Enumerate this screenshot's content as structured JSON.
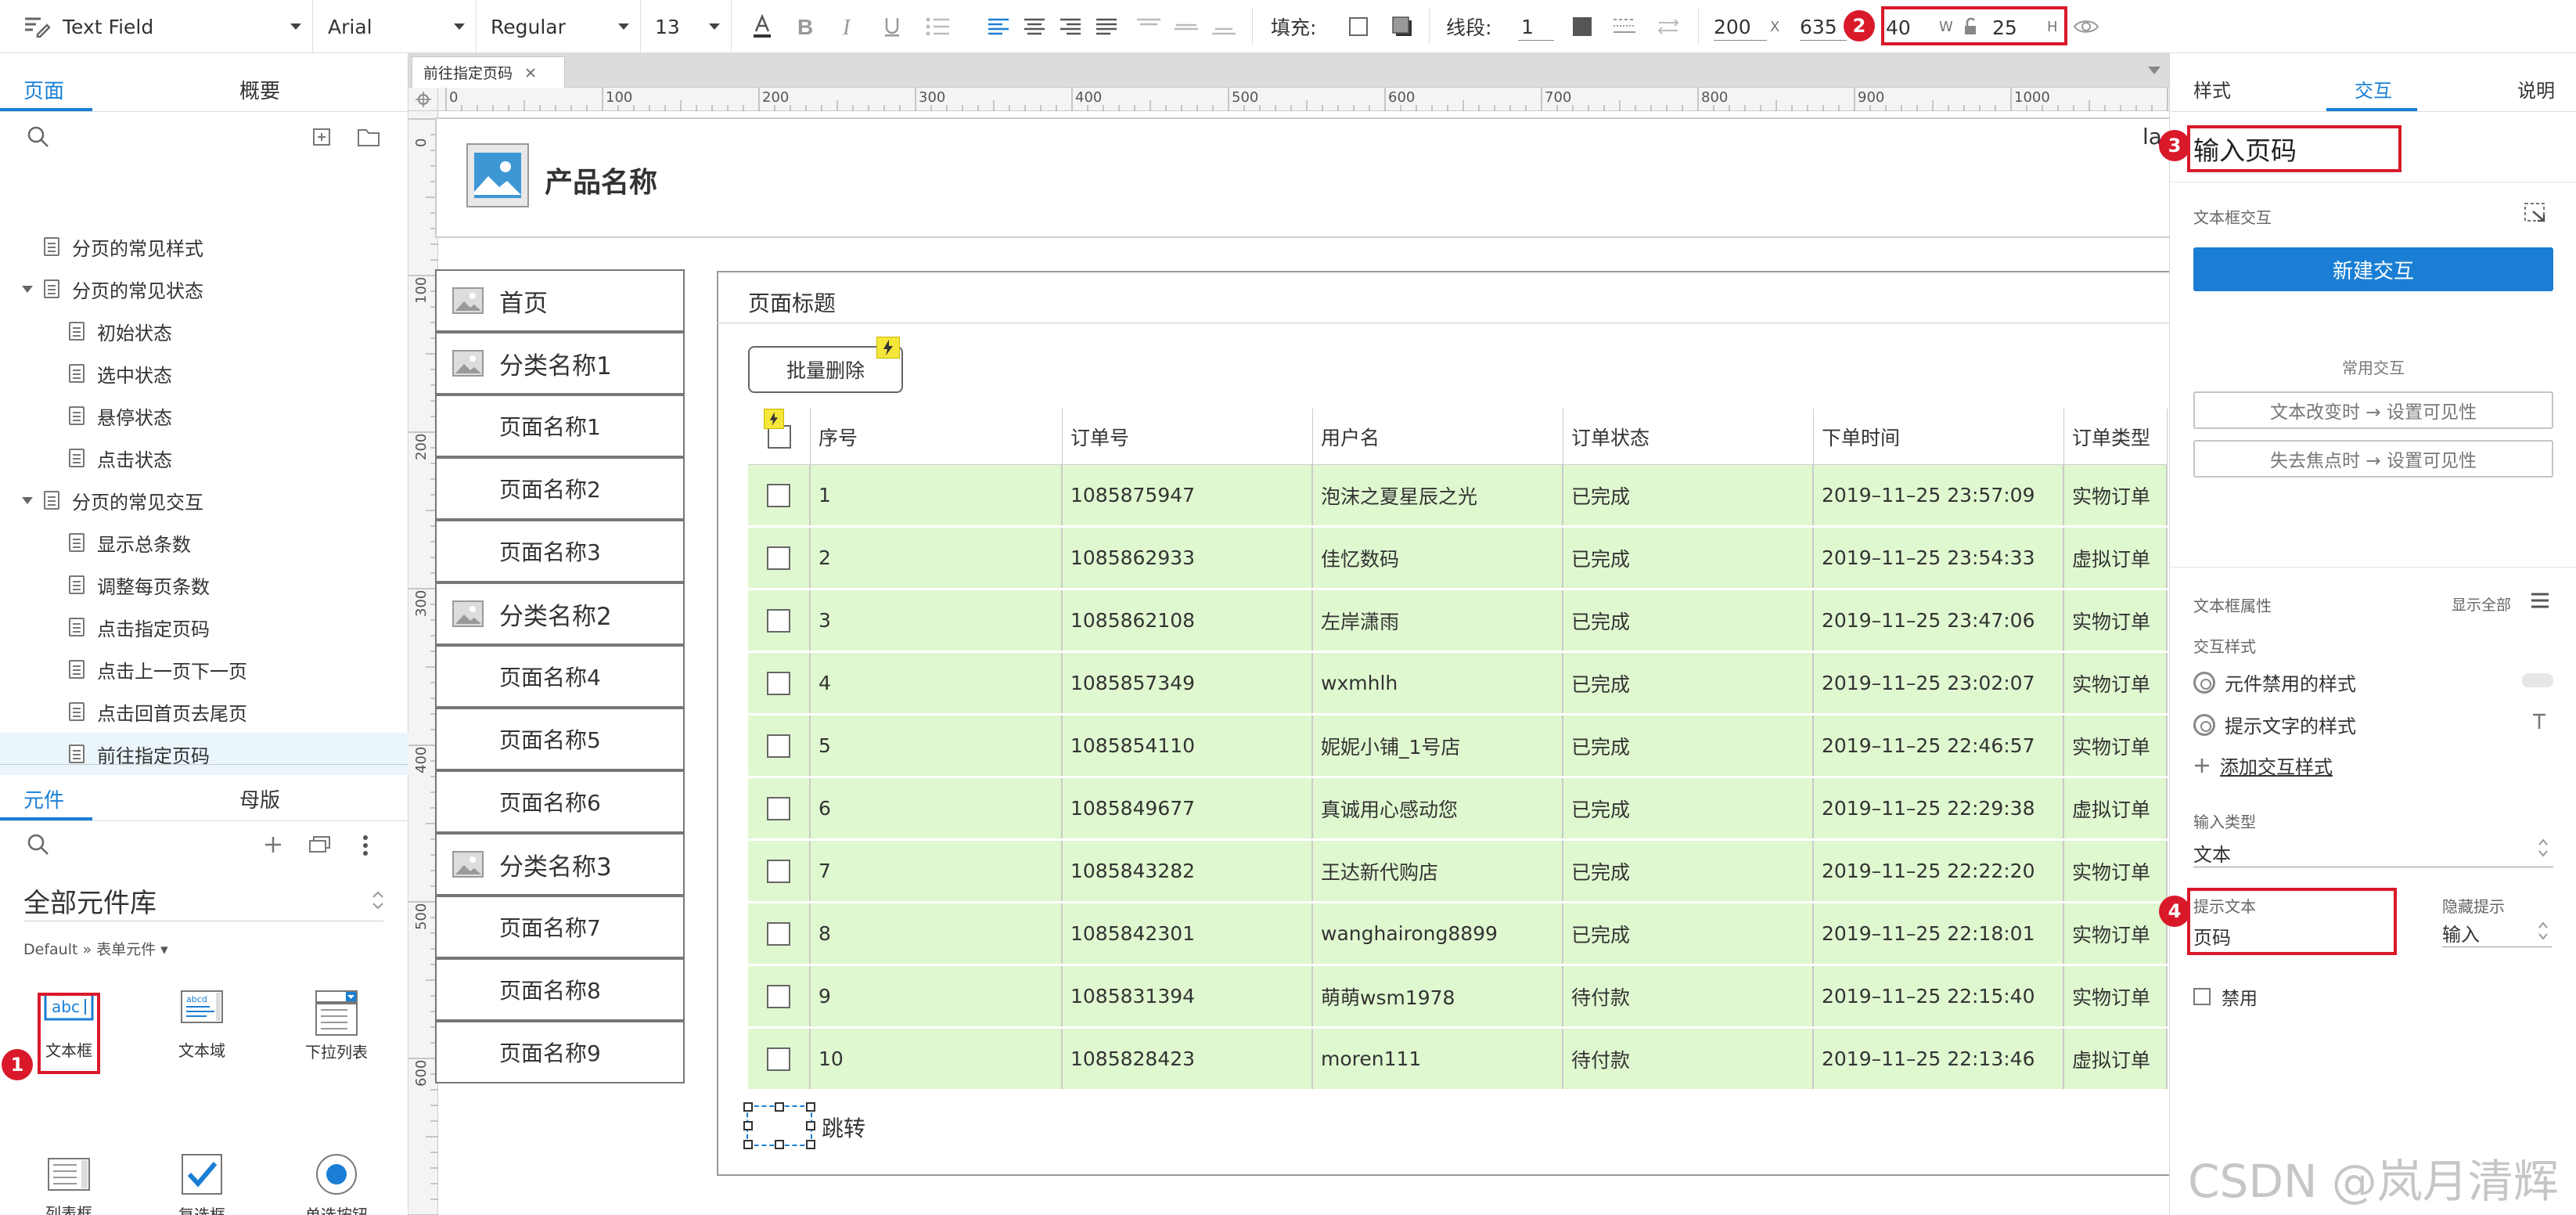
{
  "toolbar": {
    "widget_type": "Text Field",
    "font_family": "Arial",
    "font_style": "Regular",
    "font_size": "13",
    "fill_label": "填充:",
    "stroke_label": "线段:",
    "stroke_width": "1",
    "x": "200",
    "x_sep": "X",
    "y": "635",
    "w": "40",
    "w_label": "W",
    "h": "25",
    "h_label": "H"
  },
  "left_panel": {
    "tabs": [
      "页面",
      "概要"
    ],
    "active_tab": "页面",
    "tree": [
      {
        "label": "分页的常见样式",
        "level": 0,
        "expandable": false,
        "selected": false
      },
      {
        "label": "分页的常见状态",
        "level": 0,
        "expandable": true,
        "selected": false
      },
      {
        "label": "初始状态",
        "level": 1,
        "expandable": false,
        "selected": false
      },
      {
        "label": "选中状态",
        "level": 1,
        "expandable": false,
        "selected": false
      },
      {
        "label": "悬停状态",
        "level": 1,
        "expandable": false,
        "selected": false
      },
      {
        "label": "点击状态",
        "level": 1,
        "expandable": false,
        "selected": false
      },
      {
        "label": "分页的常见交互",
        "level": 0,
        "expandable": true,
        "selected": false
      },
      {
        "label": "显示总条数",
        "level": 1,
        "expandable": false,
        "selected": false
      },
      {
        "label": "调整每页条数",
        "level": 1,
        "expandable": false,
        "selected": false
      },
      {
        "label": "点击指定页码",
        "level": 1,
        "expandable": false,
        "selected": false
      },
      {
        "label": "点击上一页下一页",
        "level": 1,
        "expandable": false,
        "selected": false
      },
      {
        "label": "点击回首页去尾页",
        "level": 1,
        "expandable": false,
        "selected": false
      },
      {
        "label": "前往指定页码",
        "level": 1,
        "expandable": false,
        "selected": true
      }
    ],
    "lib_tabs": [
      "元件",
      "母版"
    ],
    "active_lib_tab": "元件",
    "library_name": "全部元件库",
    "breadcrumb": "Default » 表单元件 ▾",
    "widgets": [
      "文本框",
      "文本域",
      "下拉列表",
      "列表框",
      "复选框",
      "单选按钮"
    ]
  },
  "canvas": {
    "doc_tab": "前往指定页码",
    "ruler_h": [
      "0",
      "100",
      "200",
      "300",
      "400",
      "500",
      "600",
      "700",
      "800",
      "900",
      "1000"
    ],
    "ruler_v": [
      "0",
      "100",
      "200",
      "300",
      "400",
      "500",
      "600"
    ],
    "product_name": "产品名称",
    "nav_items": [
      {
        "label": "首页",
        "type": "category"
      },
      {
        "label": "分类名称1",
        "type": "category"
      },
      {
        "label": "页面名称1",
        "type": "page"
      },
      {
        "label": "页面名称2",
        "type": "page"
      },
      {
        "label": "页面名称3",
        "type": "page"
      },
      {
        "label": "分类名称2",
        "type": "category"
      },
      {
        "label": "页面名称4",
        "type": "page"
      },
      {
        "label": "页面名称5",
        "type": "page"
      },
      {
        "label": "页面名称6",
        "type": "page"
      },
      {
        "label": "分类名称3",
        "type": "category"
      },
      {
        "label": "页面名称7",
        "type": "page"
      },
      {
        "label": "页面名称8",
        "type": "page"
      },
      {
        "label": "页面名称9",
        "type": "page"
      }
    ],
    "page_title": "页面标题",
    "batch_delete": "批量删除",
    "table_headers": [
      "序号",
      "订单号",
      "用户名",
      "订单状态",
      "下单时间",
      "订单类型"
    ],
    "table_rows": [
      [
        "1",
        "1085875947",
        "泡沫之夏星辰之光",
        "已完成",
        "2019–11–25 23:57:09",
        "实物订单"
      ],
      [
        "2",
        "1085862933",
        "佳忆数码",
        "已完成",
        "2019–11–25 23:54:33",
        "虚拟订单"
      ],
      [
        "3",
        "1085862108",
        "左岸潇雨",
        "已完成",
        "2019–11–25 23:47:06",
        "实物订单"
      ],
      [
        "4",
        "1085857349",
        "wxmhlh",
        "已完成",
        "2019–11–25 23:02:07",
        "实物订单"
      ],
      [
        "5",
        "1085854110",
        "妮妮小铺_1号店",
        "已完成",
        "2019–11–25 22:46:57",
        "实物订单"
      ],
      [
        "6",
        "1085849677",
        "真诚用心感动您",
        "已完成",
        "2019–11–25 22:29:38",
        "虚拟订单"
      ],
      [
        "7",
        "1085843282",
        "王达新代购店",
        "已完成",
        "2019–11–25 22:22:20",
        "实物订单"
      ],
      [
        "8",
        "1085842301",
        "wanghairong8899",
        "已完成",
        "2019–11–25 22:18:01",
        "实物订单"
      ],
      [
        "9",
        "1085831394",
        "萌萌wsm1978",
        "待付款",
        "2019–11–25 22:15:40",
        "实物订单"
      ],
      [
        "10",
        "1085828423",
        "moren111",
        "待付款",
        "2019–11–25 22:13:46",
        "虚拟订单"
      ]
    ],
    "jump_label": "跳转",
    "corner_text": "la"
  },
  "right_panel": {
    "tabs": [
      "样式",
      "交互",
      "说明"
    ],
    "active_tab": "交互",
    "widget_name": "输入页码",
    "interaction_section": "文本框交互",
    "new_interaction": "新建交互",
    "common_interactions": "常用交互",
    "interaction_buttons": [
      "文本改变时 → 设置可见性",
      "失去焦点时 → 设置可见性"
    ],
    "props_section": "文本框属性",
    "show_all": "显示全部",
    "style_section": "交互样式",
    "disabled_style": "元件禁用的样式",
    "hint_style": "提示文字的样式",
    "add_style": "添加交互样式",
    "input_type_label": "输入类型",
    "input_type": "文本",
    "hint_text_label": "提示文本",
    "hint_text": "页码",
    "hide_hint_label": "隐藏提示",
    "hide_hint": "输入",
    "disabled_label": "禁用"
  },
  "markers": [
    "1",
    "2",
    "3",
    "4"
  ],
  "watermark": "CSDN @岚月清辉",
  "colors": {
    "accent": "#1a7fd4",
    "highlight": "#d9192a",
    "row_fill": "#e0f8d0",
    "selected_row": "#eaf6fb",
    "badge_yellow": "#f5e63a"
  }
}
